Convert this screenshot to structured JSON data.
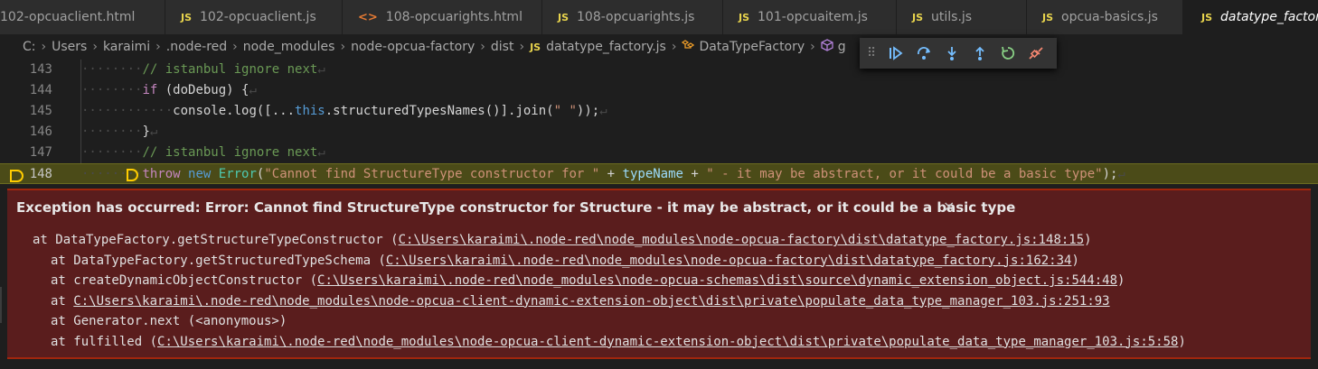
{
  "tabs": [
    {
      "icon": "html",
      "label": "102-opcuaclient.html"
    },
    {
      "icon": "js",
      "label": "102-opcuaclient.js"
    },
    {
      "icon": "html",
      "label": "108-opcuarights.html"
    },
    {
      "icon": "js",
      "label": "108-opcuarights.js"
    },
    {
      "icon": "js",
      "label": "101-opcuaitem.js"
    },
    {
      "icon": "js",
      "label": "utils.js"
    },
    {
      "icon": "js",
      "label": "opcua-basics.js"
    },
    {
      "icon": "js",
      "label": "datatype_factory.js"
    }
  ],
  "tab_icon_text": {
    "js": "JS",
    "html": "<>"
  },
  "breadcrumb": {
    "items": [
      "C:",
      "Users",
      "karaimi",
      ".node-red",
      "node_modules",
      "node-opcua-factory",
      "dist"
    ],
    "file": "datatype_factory.js",
    "file_icon": "JS",
    "class_name": "DataTypeFactory",
    "method_fragment": "g"
  },
  "debug_toolbar": {
    "buttons": [
      "continue",
      "step-over",
      "step-into",
      "step-out",
      "restart",
      "disconnect"
    ],
    "colors": {
      "continue": "#75beff",
      "step": "#75beff",
      "restart": "#89d185",
      "disconnect": "#f48771"
    }
  },
  "editor": {
    "lines": [
      {
        "num": "143",
        "indent": "········",
        "parts": [
          {
            "t": "cm",
            "v": "// istanbul ignore next"
          }
        ]
      },
      {
        "num": "144",
        "indent": "········",
        "parts": [
          {
            "t": "kw",
            "v": "if"
          },
          {
            "t": "p",
            "v": " (doDebug) {"
          }
        ]
      },
      {
        "num": "145",
        "indent": "············",
        "parts": [
          {
            "t": "p",
            "v": "console.log([..."
          },
          {
            "t": "kw2",
            "v": "this"
          },
          {
            "t": "p",
            "v": ".structuredTypesNames()].join("
          },
          {
            "t": "str",
            "v": "\" \""
          },
          {
            "t": "p",
            "v": "));"
          }
        ]
      },
      {
        "num": "146",
        "indent": "········",
        "parts": [
          {
            "t": "p",
            "v": "}"
          }
        ]
      },
      {
        "num": "147",
        "indent": "········",
        "parts": [
          {
            "t": "cm",
            "v": "// istanbul ignore next"
          }
        ]
      },
      {
        "num": "148",
        "indent": "········",
        "current": true,
        "parts": [
          {
            "t": "kw",
            "v": "throw"
          },
          {
            "t": "p",
            "v": " "
          },
          {
            "t": "kw2",
            "v": "new"
          },
          {
            "t": "p",
            "v": " "
          },
          {
            "t": "cls",
            "v": "Error"
          },
          {
            "t": "p",
            "v": "("
          },
          {
            "t": "str",
            "v": "\"Cannot find StructureType constructor for \""
          },
          {
            "t": "p",
            "v": " + "
          },
          {
            "t": "var",
            "v": "typeName"
          },
          {
            "t": "p",
            "v": " + "
          },
          {
            "t": "str",
            "v": "\" - it may be abstract, or it could be a basic type\""
          },
          {
            "t": "p",
            "v": ");"
          }
        ]
      }
    ],
    "eol_mark": "↵"
  },
  "exception": {
    "title": "Exception has occurred: Error: Cannot find StructureType constructor for Structure - it may be abstract, or it could be a basic type",
    "close": "×",
    "stack": [
      {
        "prefix": "at DataTypeFactory.getStructureTypeConstructor (",
        "link": "C:\\Users\\karaimi\\.node-red\\node_modules\\node-opcua-factory\\dist\\datatype_factory.js:148:15",
        "suffix": ")",
        "indent": false
      },
      {
        "prefix": "at DataTypeFactory.getStructuredTypeSchema (",
        "link": "C:\\Users\\karaimi\\.node-red\\node_modules\\node-opcua-factory\\dist\\datatype_factory.js:162:34",
        "suffix": ")",
        "indent": true
      },
      {
        "prefix": "at createDynamicObjectConstructor (",
        "link": "C:\\Users\\karaimi\\.node-red\\node_modules\\node-opcua-schemas\\dist\\source\\dynamic_extension_object.js:544:48",
        "suffix": ")",
        "indent": true
      },
      {
        "prefix": "at ",
        "link": "C:\\Users\\karaimi\\.node-red\\node_modules\\node-opcua-client-dynamic-extension-object\\dist\\private\\populate_data_type_manager_103.js:251:93",
        "suffix": "",
        "indent": true
      },
      {
        "prefix": "at Generator.next (<anonymous>)",
        "link": "",
        "suffix": "",
        "indent": true
      },
      {
        "prefix": "at fulfilled (",
        "link": "C:\\Users\\karaimi\\.node-red\\node_modules\\node-opcua-client-dynamic-extension-object\\dist\\private\\populate_data_type_manager_103.js:5:58",
        "suffix": ")",
        "indent": true
      }
    ]
  }
}
